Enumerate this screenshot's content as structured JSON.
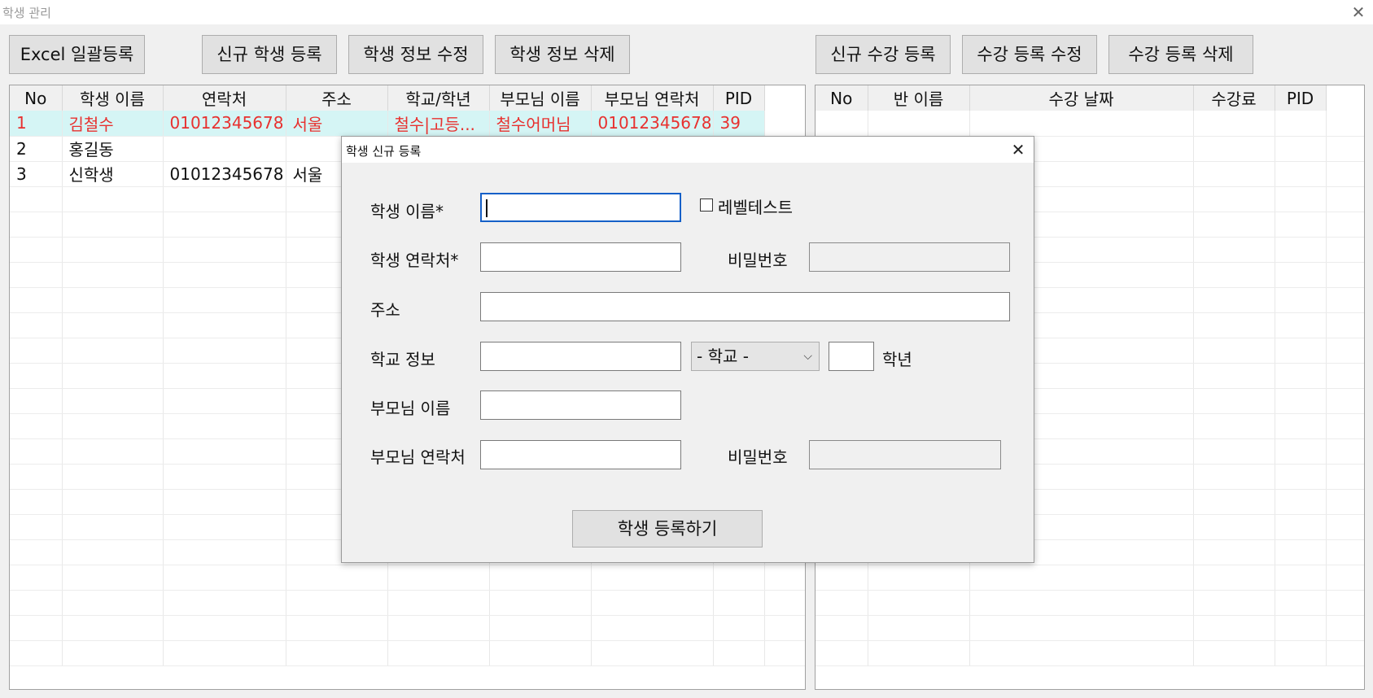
{
  "window": {
    "title": "학생 관리",
    "close_glyph": "✕"
  },
  "toolbar": {
    "excel_import": "Excel 일괄등록",
    "new_student": "신규 학생 등록",
    "edit_student": "학생 정보 수정",
    "delete_student": "학생 정보 삭제",
    "new_enrollment": "신규 수강 등록",
    "edit_enrollment": "수강 등록 수정",
    "delete_enrollment": "수강 등록 삭제"
  },
  "students_table": {
    "columns": [
      "No",
      "학생 이름",
      "연락처",
      "주소",
      "학교/학년",
      "부모님 이름",
      "부모님 연락처",
      "PID"
    ],
    "rows": [
      [
        "1",
        "김철수",
        "01012345678",
        "서울",
        "철수|고등...",
        "철수어머님",
        "01012345678",
        "39"
      ],
      [
        "2",
        "홍길동",
        "",
        "",
        "",
        "",
        "",
        ""
      ],
      [
        "3",
        "신학생",
        "01012345678",
        "서울",
        "",
        "",
        "",
        ""
      ]
    ],
    "selected_row_index": 0,
    "selected_text_color": "#e8312f",
    "selected_bg_color": "#d5f5f5"
  },
  "enrollment_table": {
    "columns": [
      "No",
      "반 이름",
      "수강 날짜",
      "수강료",
      "PID"
    ],
    "rows": []
  },
  "dialog": {
    "title": "학생 신규 등록",
    "close_glyph": "✕",
    "fields": {
      "name_label": "학생 이름*",
      "name_value": "",
      "level_test_label": "레벨테스트",
      "level_test_checked": false,
      "phone_label": "학생 연락처*",
      "phone_value": "",
      "password_label": "비밀번호",
      "password_value": "",
      "address_label": "주소",
      "address_value": "",
      "school_label": "학교 정보",
      "school_value": "",
      "school_type_selected": "- 학교 -",
      "grade_value": "",
      "grade_label": "학년",
      "parent_name_label": "부모님 이름",
      "parent_name_value": "",
      "parent_phone_label": "부모님 연락처",
      "parent_phone_value": "",
      "parent_password_label": "비밀번호",
      "parent_password_value": ""
    },
    "submit_label": "학생 등록하기",
    "focus_color": "#1560c8"
  }
}
